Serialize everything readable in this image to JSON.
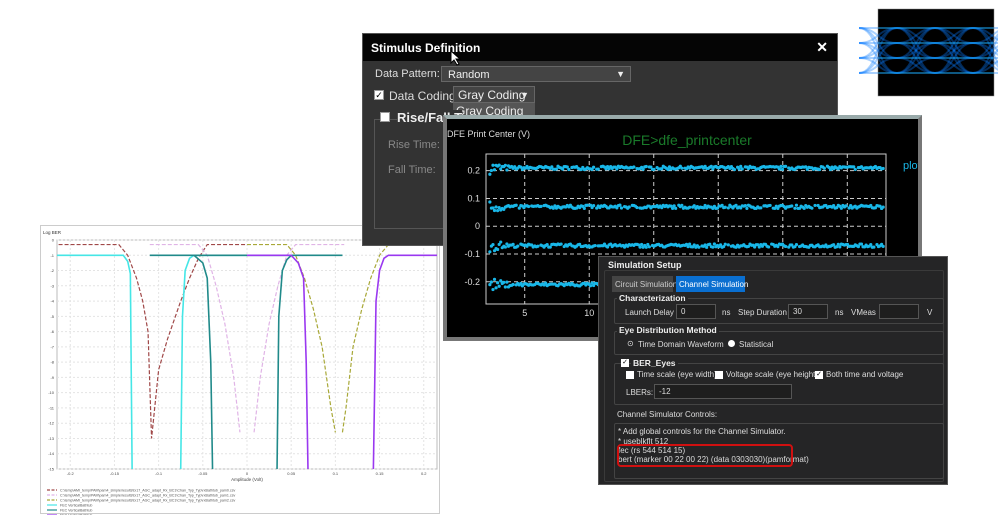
{
  "stimulus": {
    "title": "Stimulus Definition",
    "close_icon": "close-icon",
    "data_pattern_label": "Data Pattern:",
    "data_pattern_value": "Random",
    "data_coding_label": "Data Coding:",
    "data_coding_checked": true,
    "data_coding_value": "Gray Coding",
    "data_coding_options": [
      "Gray Coding"
    ],
    "rise_fall_label": "Rise/Fall T",
    "rise_time_label": "Rise Time:",
    "fall_time_label": "Fall Time:"
  },
  "dfe": {
    "ylabel": "DFE Print Center (V)",
    "title": "DFE>dfe_printcenter",
    "legend": "plot",
    "accent": "#19b7e8",
    "title_color": "#1a7a2a"
  },
  "ber": {
    "ylabel": "Log BER",
    "xlabel": "Amplitude (Volt)",
    "legend": [
      {
        "label": "C:\\temp\\AMI_temp\\PAM\\pam4_simple\\results\\tx17_AGC_adapt_Rx_BC1\\Chan_Typ_Typ\\rxBathtub_pam0.csv",
        "color": "#a04848",
        "dash": true
      },
      {
        "label": "C:\\temp\\AMI_temp\\PAM\\pam4_simple\\results\\tx17_AGC_adapt_Rx_BC1\\Chan_Typ_Typ\\rxBathtub_pam1.csv",
        "color": "#e0b4e6",
        "dash": true
      },
      {
        "label": "C:\\temp\\AMI_temp\\PAM\\pam4_simple\\results\\tx17_AGC_adapt_Rx_BC1\\Chan_Typ_Typ\\rxBathtub_pam2.csv",
        "color": "#a8a838",
        "dash": true
      },
      {
        "label": "FEC VerticalBathtub",
        "color": "#45e6e6",
        "dash": false
      },
      {
        "label": "FEC VerticalBathtub",
        "color": "#208a8a",
        "dash": false
      },
      {
        "label": "FEC VerticalBathtub",
        "color": "#9a38f0",
        "dash": false
      }
    ]
  },
  "sim": {
    "title": "Simulation Setup",
    "tabs": [
      {
        "label": "Circuit Simulation",
        "active": false
      },
      {
        "label": "Channel Simulation",
        "active": true
      }
    ],
    "characterization": {
      "title": "Characterization",
      "launch_delay_label": "Launch Delay",
      "launch_delay": "0",
      "unit1": "ns",
      "step_duration_label": "Step Duration",
      "step_duration": "30",
      "unit2": "ns",
      "vmeas_label": "VMeas",
      "vmeas": "",
      "unit3": "V"
    },
    "eye_method": {
      "title": "Eye Distribution Method",
      "options": [
        "Time Domain Waveform",
        "Statistical"
      ],
      "selected": "Time Domain Waveform"
    },
    "ber_eyes": {
      "title": "BER_Eyes",
      "checked": true,
      "time_scale": "Time scale (eye width)",
      "voltage_scale": "Voltage scale (eye height)",
      "both": "Both time and voltage",
      "lbers_label": "LBERs:",
      "lbers": "-12"
    },
    "controls_label": "Channel Simulator Controls:",
    "controls_lines": [
      "* Add global controls for the Channel Simulator.",
      "* useblkflt 512",
      "fec (rs 544 514 15)",
      "bert (marker 00 22 00 22) (data 0303030)(pamformat)"
    ],
    "highlight_color": "#d01010",
    "active_tab_color": "#0a6fd0"
  },
  "chart_data": [
    {
      "type": "scatter",
      "title": "DFE>dfe_printcenter",
      "ylabel": "DFE Print Center (V)",
      "xlim": [
        2,
        33
      ],
      "ylim": [
        -0.28,
        0.26
      ],
      "xticks": [
        5,
        10
      ],
      "yticks": [
        0.2,
        0.1,
        0,
        -0.1,
        -0.2
      ],
      "grid": true,
      "series": [
        {
          "name": "plot",
          "levels": [
            0.21,
            0.07,
            -0.07,
            -0.21
          ]
        }
      ]
    },
    {
      "type": "line",
      "ylabel": "Log BER",
      "xlabel": "Amplitude (Volt)",
      "xlim": [
        -0.215,
        0.215
      ],
      "ylim": [
        -15,
        0
      ],
      "xticks": [
        -0.2,
        -0.15,
        -0.1,
        -0.05,
        0,
        0.05,
        0.1,
        0.15,
        0.2
      ],
      "yticks": [
        0,
        -1,
        -2,
        -3,
        -4,
        -5,
        -6,
        -7,
        -8,
        -9,
        -10,
        -11,
        -12,
        -13,
        -14,
        -15
      ],
      "grid": true,
      "legend": "bottom",
      "series": [
        {
          "segments": [
            [
              [
                -0.22,
                -0.3
              ],
              [
                -0.145,
                -0.3
              ],
              [
                -0.135,
                -1
              ],
              [
                -0.125,
                -2.5
              ],
              [
                -0.118,
                -4
              ],
              [
                -0.112,
                -6
              ],
              [
                -0.108,
                -13
              ],
              [
                -0.1,
                -8.5
              ],
              [
                -0.09,
                -6.5
              ],
              [
                -0.075,
                -4
              ],
              [
                -0.065,
                -2.5
              ],
              [
                -0.055,
                -1.2
              ],
              [
                -0.045,
                -0.3
              ],
              [
                0,
                -0.3
              ]
            ]
          ]
        },
        {
          "segments": [
            [
              [
                -0.11,
                -0.3
              ],
              [
                -0.055,
                -0.3
              ],
              [
                -0.045,
                -1
              ],
              [
                -0.035,
                -3
              ],
              [
                -0.025,
                -5.5
              ],
              [
                -0.015,
                -9
              ],
              [
                -0.008,
                -12.6
              ]
            ],
            [
              [
                0.008,
                -12.6
              ],
              [
                0.015,
                -9
              ],
              [
                0.025,
                -5.5
              ],
              [
                0.035,
                -3
              ],
              [
                0.045,
                -1
              ],
              [
                0.055,
                -0.3
              ],
              [
                0.11,
                -0.3
              ]
            ]
          ]
        },
        {
          "segments": [
            [
              [
                0,
                -0.3
              ],
              [
                0.045,
                -0.3
              ],
              [
                0.055,
                -1
              ],
              [
                0.065,
                -2.5
              ],
              [
                0.075,
                -4.5
              ],
              [
                0.085,
                -7
              ],
              [
                0.095,
                -11
              ],
              [
                0.1,
                -12.6
              ]
            ],
            [
              [
                0.108,
                -12.6
              ],
              [
                0.112,
                -11
              ],
              [
                0.12,
                -7
              ],
              [
                0.13,
                -4.5
              ],
              [
                0.14,
                -2.5
              ],
              [
                0.15,
                -1
              ],
              [
                0.16,
                -0.3
              ],
              [
                0.22,
                -0.3
              ]
            ]
          ]
        },
        {
          "segments": [
            [
              [
                -0.22,
                -1
              ],
              [
                -0.14,
                -1
              ],
              [
                -0.135,
                -1.4
              ],
              [
                -0.132,
                -2.2
              ],
              [
                -0.13,
                -15
              ]
            ],
            [
              [
                -0.075,
                -15
              ],
              [
                -0.073,
                -5
              ],
              [
                -0.07,
                -2
              ],
              [
                -0.065,
                -1.2
              ],
              [
                -0.06,
                -1
              ],
              [
                0,
                -1
              ]
            ]
          ]
        },
        {
          "segments": [
            [
              [
                -0.11,
                -1
              ],
              [
                0.108,
                -1
              ]
            ],
            [
              [
                -0.06,
                -1
              ],
              [
                -0.05,
                -1.5
              ],
              [
                -0.045,
                -2.5
              ],
              [
                -0.041,
                -8
              ],
              [
                -0.039,
                -15
              ]
            ],
            [
              [
                0.034,
                -15
              ],
              [
                0.036,
                -5
              ],
              [
                0.04,
                -2
              ],
              [
                0.045,
                -1.3
              ],
              [
                0.05,
                -1
              ]
            ]
          ]
        },
        {
          "segments": [
            [
              [
                0,
                -1
              ],
              [
                0.05,
                -1
              ],
              [
                0.058,
                -1.5
              ],
              [
                0.064,
                -2.5
              ],
              [
                0.067,
                -8
              ],
              [
                0.069,
                -15
              ]
            ],
            [
              [
                0.143,
                -15
              ],
              [
                0.146,
                -4
              ],
              [
                0.15,
                -2
              ],
              [
                0.155,
                -1.2
              ],
              [
                0.16,
                -1
              ],
              [
                0.22,
                -1
              ]
            ]
          ]
        }
      ]
    }
  ]
}
